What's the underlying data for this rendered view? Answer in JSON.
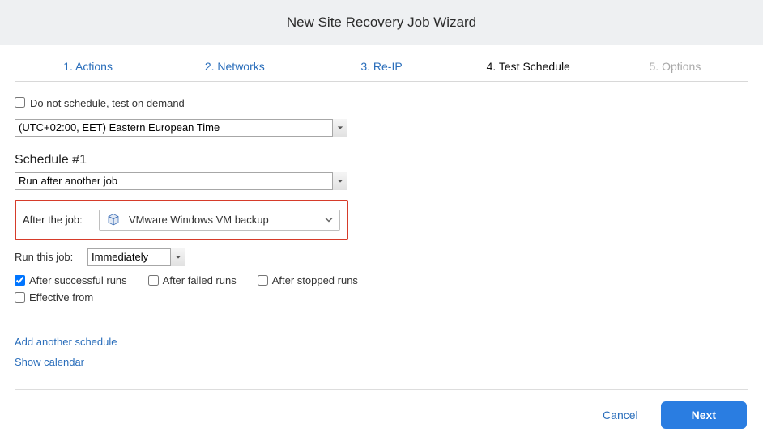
{
  "header": {
    "title": "New Site Recovery Job Wizard"
  },
  "tabs": [
    {
      "label": "1. Actions",
      "state": "link"
    },
    {
      "label": "2. Networks",
      "state": "link"
    },
    {
      "label": "3. Re-IP",
      "state": "link"
    },
    {
      "label": "4. Test Schedule",
      "state": "active"
    },
    {
      "label": "5. Options",
      "state": "disabled"
    }
  ],
  "form": {
    "no_schedule_label": "Do not schedule, test on demand",
    "no_schedule_checked": false,
    "timezone_value": "(UTC+02:00, EET) Eastern European Time",
    "schedule_title": "Schedule #1",
    "schedule_type_value": "Run after another job",
    "after_job_label": "After the job:",
    "after_job_value": "VMware Windows VM backup",
    "run_this_job_label": "Run this job:",
    "run_this_job_value": "Immediately",
    "after_successful_label": "After successful runs",
    "after_successful_checked": true,
    "after_failed_label": "After failed runs",
    "after_failed_checked": false,
    "after_stopped_label": "After stopped runs",
    "after_stopped_checked": false,
    "effective_from_label": "Effective from",
    "effective_from_checked": false
  },
  "links": {
    "add_schedule": "Add another schedule",
    "show_calendar": "Show calendar"
  },
  "footer": {
    "cancel": "Cancel",
    "next": "Next"
  }
}
